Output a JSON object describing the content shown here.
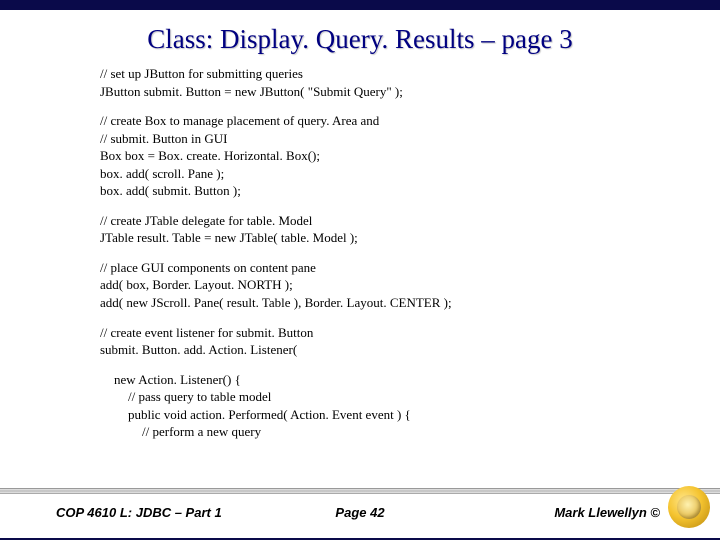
{
  "title": "Class:  Display. Query. Results – page 3",
  "code": {
    "b1l1": "// set up JButton for submitting queries",
    "b1l2": "JButton submit. Button = new JButton( \"Submit Query\" );",
    "b2l1": "// create Box to manage placement of query. Area and",
    "b2l2": "// submit. Button in GUI",
    "b2l3": "Box box = Box. create. Horizontal. Box();",
    "b2l4": "box. add( scroll. Pane );",
    "b2l5": "box. add( submit. Button );",
    "b3l1": "// create JTable delegate for table. Model",
    "b3l2": "JTable result. Table = new JTable( table. Model );",
    "b4l1": "// place GUI components on content pane",
    "b4l2": "add( box, Border. Layout. NORTH );",
    "b4l3": "add( new JScroll. Pane( result. Table ), Border. Layout. CENTER );",
    "b5l1": "// create event listener for submit. Button",
    "b5l2": "submit. Button. add. Action. Listener(",
    "b6l1": "new Action. Listener() {",
    "b6l2": "// pass query to table model",
    "b6l3": "public void action. Performed( Action. Event event ) {",
    "b6l4": "// perform a new query"
  },
  "footer": {
    "left": "COP 4610 L: JDBC – Part 1",
    "center": "Page 42",
    "right": "Mark Llewellyn ©"
  }
}
